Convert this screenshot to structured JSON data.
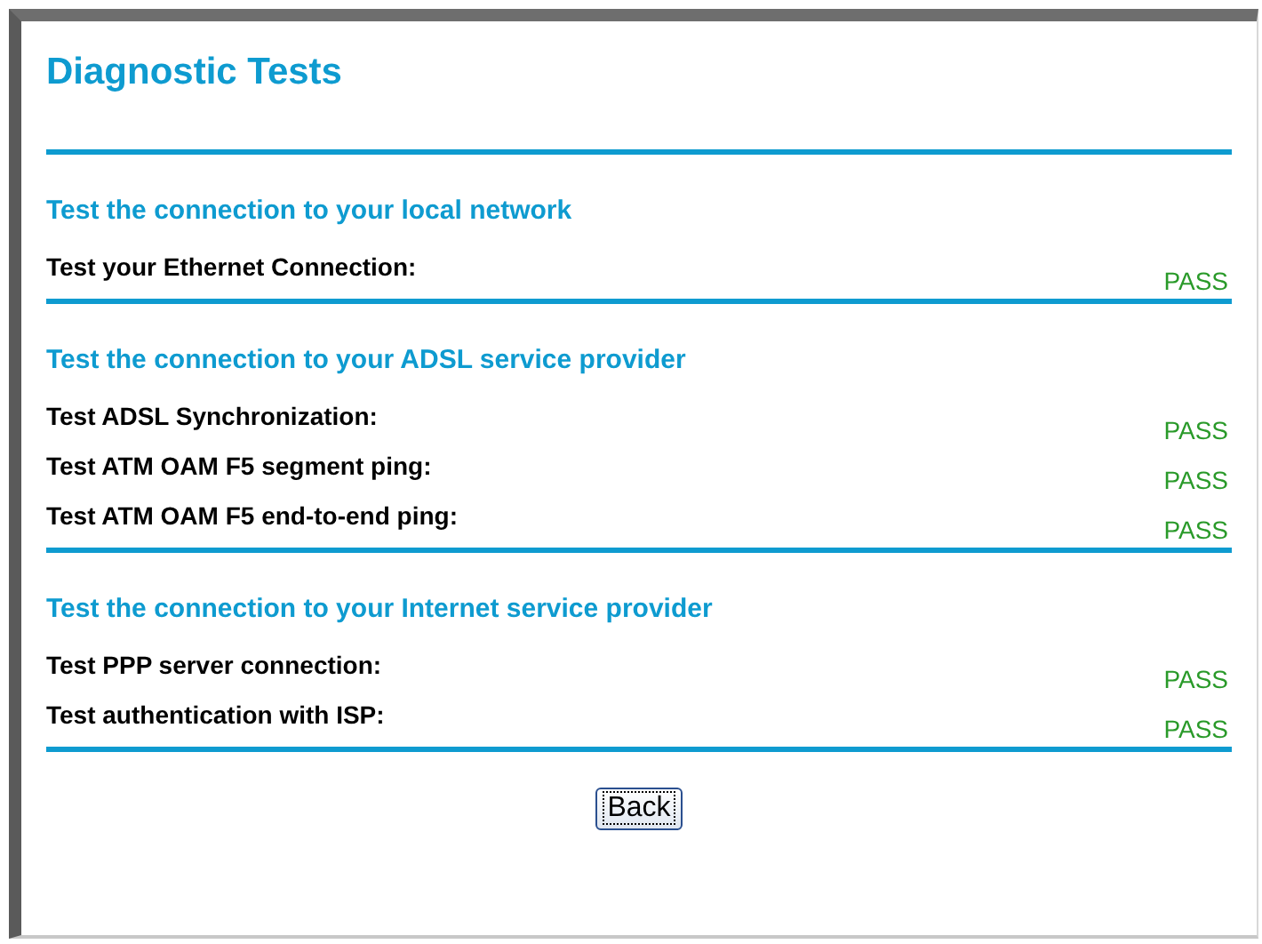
{
  "title": "Diagnostic Tests",
  "sections": [
    {
      "heading": "Test the connection to your local network",
      "tests": [
        {
          "label": "Test your Ethernet Connection:",
          "result": "PASS"
        }
      ]
    },
    {
      "heading": "Test the connection to your ADSL service provider",
      "tests": [
        {
          "label": "Test ADSL Synchronization:",
          "result": "PASS"
        },
        {
          "label": "Test ATM OAM F5 segment ping:",
          "result": "PASS"
        },
        {
          "label": "Test ATM OAM F5 end-to-end ping:",
          "result": "PASS"
        }
      ]
    },
    {
      "heading": "Test the connection to your Internet service provider",
      "tests": [
        {
          "label": "Test PPP server connection:",
          "result": "PASS"
        },
        {
          "label": "Test authentication with ISP:",
          "result": "PASS"
        }
      ]
    }
  ],
  "button": "Back"
}
